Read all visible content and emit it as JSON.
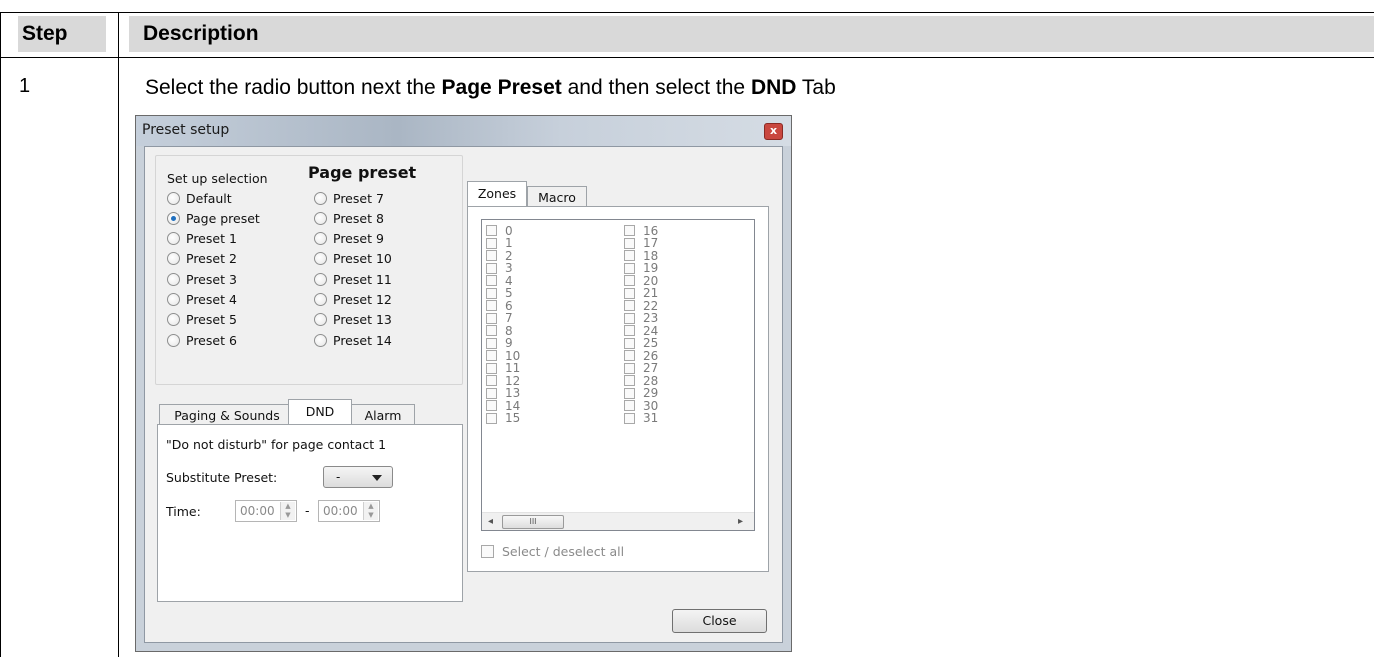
{
  "table": {
    "header_step": "Step",
    "header_description": "Description",
    "step_number": "1",
    "instruction_before": "Select the radio button next the ",
    "instruction_bold1": "Page Preset",
    "instruction_middle": " and then select the ",
    "instruction_bold2": "DND",
    "instruction_after": " Tab"
  },
  "dialog": {
    "title": "Preset setup",
    "close_glyph": "x",
    "setup_selection_label": "Set up selection",
    "page_preset_header": "Page preset",
    "left_radios": [
      {
        "label": "Default",
        "selected": false
      },
      {
        "label": "Page preset",
        "selected": true
      },
      {
        "label": "Preset 1",
        "selected": false
      },
      {
        "label": "Preset 2",
        "selected": false
      },
      {
        "label": "Preset 3",
        "selected": false
      },
      {
        "label": "Preset 4",
        "selected": false
      },
      {
        "label": "Preset 5",
        "selected": false
      },
      {
        "label": "Preset 6",
        "selected": false
      }
    ],
    "right_radios": [
      {
        "label": "Preset 7",
        "selected": false
      },
      {
        "label": "Preset 8",
        "selected": false
      },
      {
        "label": "Preset 9",
        "selected": false
      },
      {
        "label": "Preset 10",
        "selected": false
      },
      {
        "label": "Preset 11",
        "selected": false
      },
      {
        "label": "Preset 12",
        "selected": false
      },
      {
        "label": "Preset 13",
        "selected": false
      },
      {
        "label": "Preset 14",
        "selected": false
      }
    ],
    "tabs": {
      "paging": "Paging & Sounds",
      "dnd": "DND",
      "alarm": "Alarm",
      "active": "DND"
    },
    "dnd_panel": {
      "heading": "\"Do not disturb\" for page contact 1",
      "substitute_label": "Substitute Preset:",
      "substitute_value": "-",
      "time_label": "Time:",
      "time_from": "00:00",
      "time_separator": "-",
      "time_to": "00:00"
    },
    "zone_tabs": {
      "zones": "Zones",
      "macro": "Macro",
      "active": "Zones"
    },
    "zones_col1": [
      "0",
      "1",
      "2",
      "3",
      "4",
      "5",
      "6",
      "7",
      "8",
      "9",
      "10",
      "11",
      "12",
      "13",
      "14",
      "15"
    ],
    "zones_col2": [
      "16",
      "17",
      "18",
      "19",
      "20",
      "21",
      "22",
      "23",
      "24",
      "25",
      "26",
      "27",
      "28",
      "29",
      "30",
      "31"
    ],
    "scroll_thumb_glyph": "III",
    "select_all_label": "Select / deselect all",
    "close_button": "Close",
    "icons": {
      "close": "close-icon",
      "combo_arrow": "chevron-down-icon",
      "spin": "spin-updown-icon",
      "scroll_left": "arrow-left-icon",
      "scroll_right": "arrow-right-icon"
    }
  }
}
